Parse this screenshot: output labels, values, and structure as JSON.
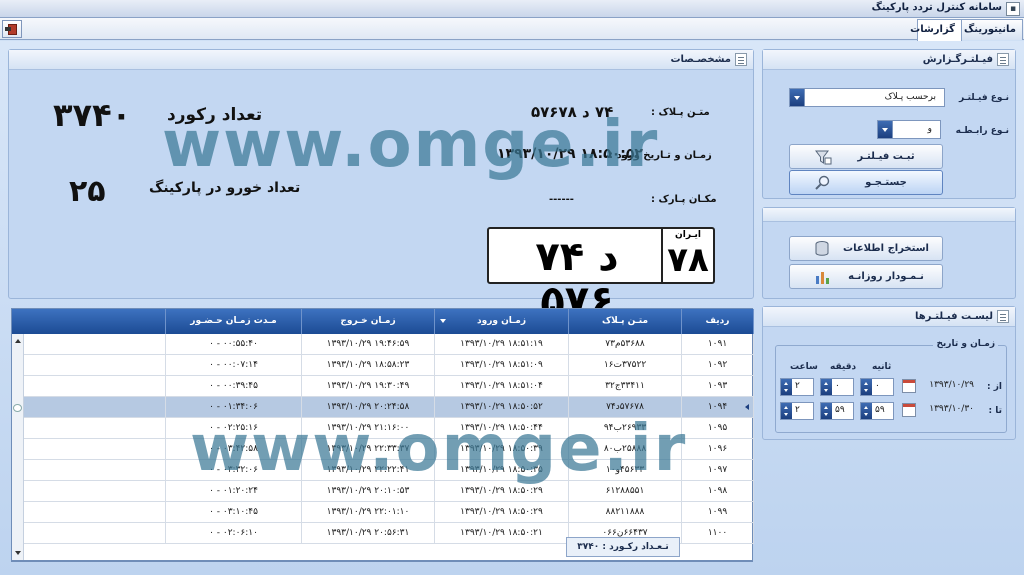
{
  "window": {
    "title": "سامانه کنترل تردد پارکینگ"
  },
  "tabs": [
    {
      "label": "مانیتورینگ"
    },
    {
      "label": "گزارشات"
    }
  ],
  "specs": {
    "title": "مشخصـصات",
    "record_count_label": "تعداد رکورد",
    "record_count": "۳۷۴۰",
    "vehicles_label": "تعداد خورو در پارکینگ",
    "vehicles_count": "۲۵",
    "plate_text_label": "متـن پـلاک :",
    "plate_text_value": "۷۴ د ۵۷۶۷۸",
    "entry_label": "زمـان و تـاریخ ورود :",
    "entry_value": "۱۳۹۳/۱۰/۲۹  ۱۸:۵۰:۵۲",
    "location_label": "مکـان پـارک :",
    "location_value": "------",
    "plate": {
      "main": "۷۴ د ۵۷۶",
      "iran": "ایـران",
      "code": "۷۸"
    }
  },
  "report": {
    "title": "فیـلتـرگـزارش",
    "filter_type_label": "نـوع فیـلتـر",
    "filter_type_value": "برحسب پـلاک",
    "relation_type_label": "نـوع رابـطـه",
    "relation_type_value": "و",
    "register_filter": "ثبـت فیـلتـر",
    "search": "جستـجـو"
  },
  "extract": {
    "extract_info": "استخراج اطلاعات",
    "daily_chart": "نـمـودار روزانـه"
  },
  "filter_list": {
    "title": "لیسـت فیـلتـرها",
    "group_title": "زمـان و تاریخ",
    "col_sec": "ثانیه",
    "col_min": "دقیقه",
    "col_hour": "ساعت",
    "from_label": "از :",
    "to_label": "تا :",
    "from_date": "۱۳۹۳/۱۰/۲۹",
    "to_date": "۱۳۹۳/۱۰/۳۰",
    "from_sec": "۰",
    "from_min": "۰",
    "from_hour": "۲",
    "to_sec": "۵۹",
    "to_min": "۵۹",
    "to_hour": "۲"
  },
  "grid": {
    "columns": [
      "ردیف",
      "متـن پـلاک",
      "زمـان ورود",
      "زمـان خـروج",
      "مـدت زمـان حـضـور"
    ],
    "rows": [
      [
        "۱۰۹۱",
        "۵۳۶۸۸م۷۳",
        "۱۳۹۳/۱۰/۲۹  ۱۸:۵۱:۱۹",
        "۱۳۹۳/۱۰/۲۹  ۱۹:۴۶:۵۹",
        "۰  -  ۰۰:۵۵:۴۰"
      ],
      [
        "۱۰۹۲",
        "۳۷۵۲۲ت۱۶",
        "۱۳۹۳/۱۰/۲۹  ۱۸:۵۱:۰۹",
        "۱۳۹۳/۱۰/۲۹  ۱۸:۵۸:۲۳",
        "۰  -  ۰۰:۰۷:۱۴"
      ],
      [
        "۱۰۹۳",
        "۳۳۴۱۱ج۳۲",
        "۱۳۹۳/۱۰/۲۹  ۱۸:۵۱:۰۴",
        "۱۳۹۳/۱۰/۲۹  ۱۹:۳۰:۴۹",
        "۰  -  ۰۰:۳۹:۴۵"
      ],
      [
        "۱۰۹۴",
        "۵۷۶۷۸د۷۴",
        "۱۳۹۳/۱۰/۲۹  ۱۸:۵۰:۵۲",
        "۱۳۹۳/۱۰/۲۹  ۲۰:۲۴:۵۸",
        "۰  -  ۰۱:۳۴:۰۶"
      ],
      [
        "۱۰۹۵",
        "۲۶۹۳۳ب۹۴",
        "۱۳۹۳/۱۰/۲۹  ۱۸:۵۰:۴۴",
        "۱۳۹۳/۱۰/۲۹  ۲۱:۱۶:۰۰",
        "۰  -  ۰۲:۲۵:۱۶"
      ],
      [
        "۱۰۹۶",
        "۲۵۸۸۸ب۸۰",
        "۱۳۹۳/۱۰/۲۹  ۱۸:۵۰:۳۹",
        "۱۳۹۳/۱۰/۲۹  ۲۲:۳۳:۳۷",
        "۰  -  ۰۳:۴۲:۵۸"
      ],
      [
        "۱۰۹۷",
        "۴۵۶۳۳و۱۰",
        "۱۳۹۳/۱۰/۲۹  ۱۸:۵۰:۳۵",
        "۱۳۹۳/۱۰/۲۹  ۲۲:۲۲:۴۱",
        "۰  -  ۰۳:۳۲:۰۶"
      ],
      [
        "۱۰۹۸",
        "۶۱۲۸۸۵۵۱",
        "۱۳۹۳/۱۰/۲۹  ۱۸:۵۰:۲۹",
        "۱۳۹۳/۱۰/۲۹  ۲۰:۱۰:۵۳",
        "۰  -  ۰۱:۲۰:۲۴"
      ],
      [
        "۱۰۹۹",
        "۸۸۲۱۱۸۸۸",
        "۱۳۹۳/۱۰/۲۹  ۱۸:۵۰:۲۹",
        "۱۳۹۳/۱۰/۲۹  ۲۲:۰۱:۱۰",
        "۰  -  ۰۳:۱۰:۴۵"
      ],
      [
        "۱۱۰۰",
        "۶۶۴۳۷ن۰۶۶",
        "۱۳۹۳/۱۰/۲۹  ۱۸:۵۰:۲۱",
        "۱۳۹۳/۱۰/۲۹  ۲۰:۵۶:۳۱",
        "۰  -  ۰۲:۰۶:۱۰"
      ]
    ],
    "selected_row": 3,
    "record_count_footer": "تـعـداد رکـورد : ۳۷۴۰"
  },
  "watermark": {
    "text": "www.omge.ir"
  }
}
